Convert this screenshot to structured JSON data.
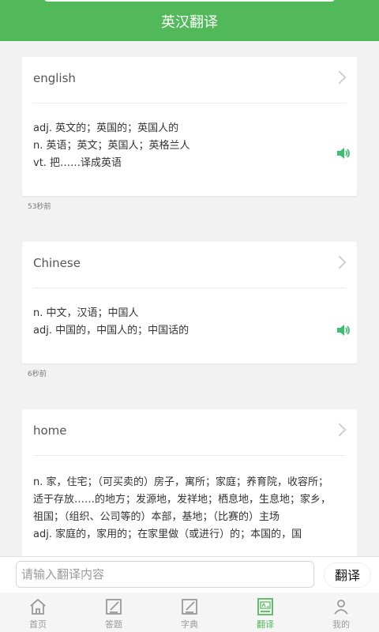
{
  "header": {
    "title": "英汉翻译"
  },
  "results": [
    {
      "word": "english",
      "definitions": [
        "adj. 英文的；英国的；英国人的",
        "n. 英语；英文；英国人；英格兰人",
        "vt. 把……译成英语"
      ],
      "time": "53秒前"
    },
    {
      "word": "Chinese",
      "definitions": [
        "n. 中文，汉语；中国人",
        "adj. 中国的，中国人的；中国话的"
      ],
      "time": "6秒前"
    },
    {
      "word": "home",
      "definitions": [
        "n. 家，住宅；（可买卖的）房子，寓所；家庭；养育院，收容所；适于存放……的地方；发源地，发祥地；栖息地，生息地；家乡，祖国；（组织、公司等的）本部，基地；（比赛的）主场",
        "adj. 家庭的，家用的；在家里做（或进行）的；本国的，国"
      ],
      "time": ""
    }
  ],
  "input": {
    "placeholder": "请输入翻译内容",
    "value": ""
  },
  "translate_button": "翻译",
  "tabs": [
    {
      "label": "首页",
      "icon": "home-icon"
    },
    {
      "label": "答题",
      "icon": "edit-icon"
    },
    {
      "label": "字典",
      "icon": "edit-icon"
    },
    {
      "label": "翻译",
      "icon": "book-icon",
      "active": true
    },
    {
      "label": "我的",
      "icon": "user-icon"
    }
  ],
  "colors": {
    "primary": "#52b95a",
    "speaker": "#3cbf73"
  }
}
